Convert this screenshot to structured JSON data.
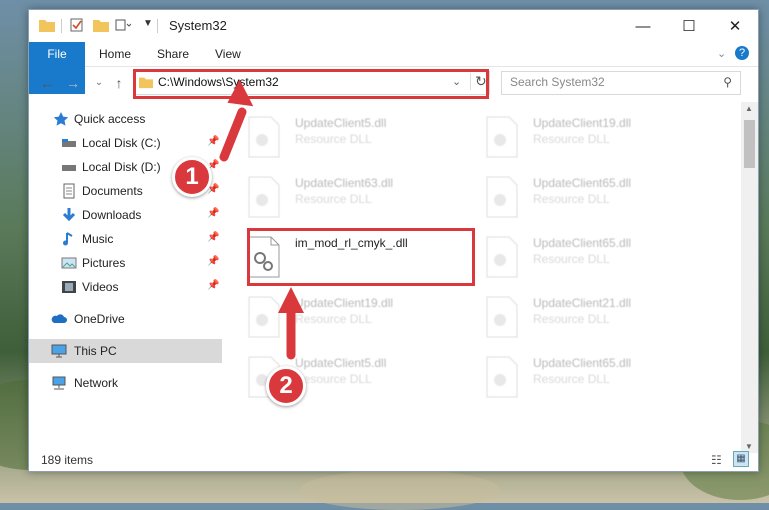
{
  "window": {
    "title": "System32"
  },
  "controls": {
    "minimize": "—",
    "maximize": "☐",
    "close": "✕"
  },
  "ribbon": {
    "tabs": [
      "File",
      "Home",
      "Share",
      "View"
    ]
  },
  "address": {
    "path": "C:\\Windows\\System32"
  },
  "search": {
    "placeholder": "Search System32"
  },
  "nav": {
    "items": [
      {
        "label": "Quick access",
        "icon": "star-icon"
      },
      {
        "label": "Local Disk (C:)",
        "icon": "drive-icon"
      },
      {
        "label": "Local Disk (D:)",
        "icon": "drive-icon"
      },
      {
        "label": "Documents",
        "icon": "documents-icon"
      },
      {
        "label": "Downloads",
        "icon": "download-icon"
      },
      {
        "label": "Music",
        "icon": "music-icon"
      },
      {
        "label": "Pictures",
        "icon": "pictures-icon"
      },
      {
        "label": "Videos",
        "icon": "videos-icon"
      },
      {
        "label": "OneDrive",
        "icon": "cloud-icon"
      },
      {
        "label": "This PC",
        "icon": "computer-icon"
      },
      {
        "label": "Network",
        "icon": "network-icon"
      }
    ]
  },
  "files": [
    {
      "name": "UpdateClient5.dll",
      "type": "Resource DLL"
    },
    {
      "name": "UpdateClient19.dll",
      "type": "Resource DLL"
    },
    {
      "name": "UpdateClient63.dll",
      "type": "Resource DLL"
    },
    {
      "name": "UpdateClient65.dll",
      "type": "Resource DLL"
    },
    {
      "name": "im_mod_rl_cmyk_.dll",
      "type": ""
    },
    {
      "name": "UpdateClient65.dll",
      "type": "Resource DLL"
    },
    {
      "name": "UpdateClient19.dll",
      "type": "Resource DLL"
    },
    {
      "name": "UpdateClient21.dll",
      "type": "Resource DLL"
    },
    {
      "name": "UpdateClient5.dll",
      "type": "Resource DLL"
    },
    {
      "name": "UpdateClient65.dll",
      "type": "Resource DLL"
    }
  ],
  "status": {
    "item_count": "189 items"
  },
  "callouts": {
    "one": "1",
    "two": "2"
  },
  "colors": {
    "accent": "#1979ca",
    "highlight": "#d9393d"
  }
}
